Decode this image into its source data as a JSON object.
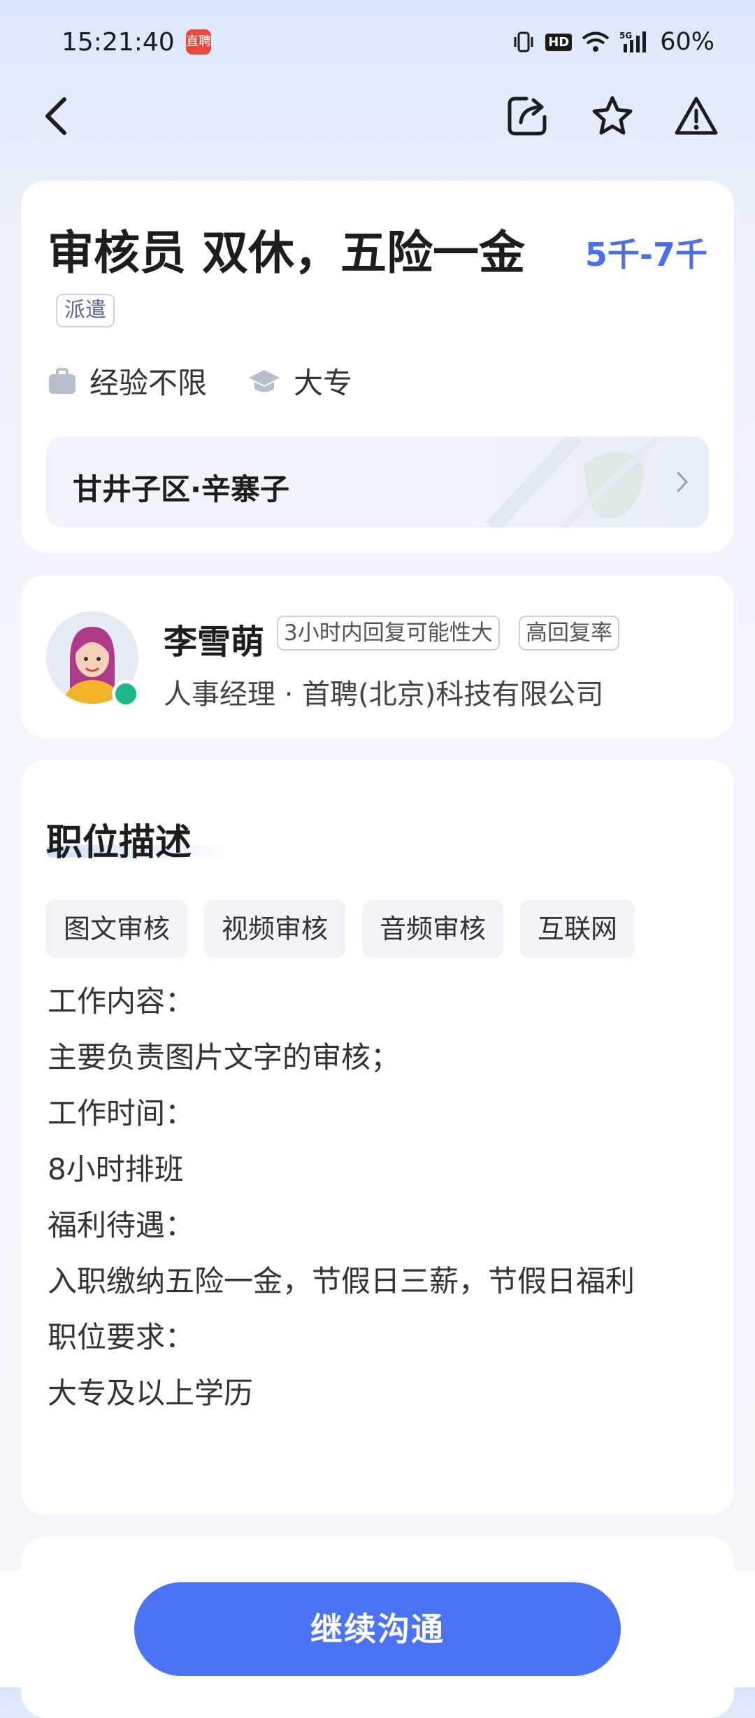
{
  "status": {
    "time": "15:21:40",
    "app_badge": "直聘",
    "hd": "HD",
    "battery": "60%"
  },
  "nav": {
    "back_icon": "back-arrow-icon",
    "share_icon": "share-icon",
    "favorite_icon": "star-icon",
    "report_icon": "warning-icon"
  },
  "job": {
    "title": "审核员 双休，五险一金",
    "type_tag": "派遣",
    "salary": "5千-7千",
    "experience": "经验不限",
    "education": "大专",
    "location": "甘井子区·辛寨子"
  },
  "recruiter": {
    "name": "李雪萌",
    "tag_reply": "3小时内回复可能性大",
    "tag_rate": "高回复率",
    "subtitle": "人事经理 · 首聘(北京)科技有限公司",
    "online": true
  },
  "description": {
    "title": "职位描述",
    "skills": [
      "图文审核",
      "视频审核",
      "音频审核",
      "互联网"
    ],
    "lines": [
      "工作内容：",
      "主要负责图片文字的审核；",
      "工作时间：",
      "8小时排班",
      "福利待遇：",
      "入职缴纳五险一金，节假日三薪，节假日福利",
      "职位要求：",
      "大专及以上学历"
    ]
  },
  "cta": {
    "label": "继续沟通"
  },
  "colors": {
    "accent": "#4a74f5",
    "salary": "#4c71e6",
    "online": "#19b98a"
  }
}
